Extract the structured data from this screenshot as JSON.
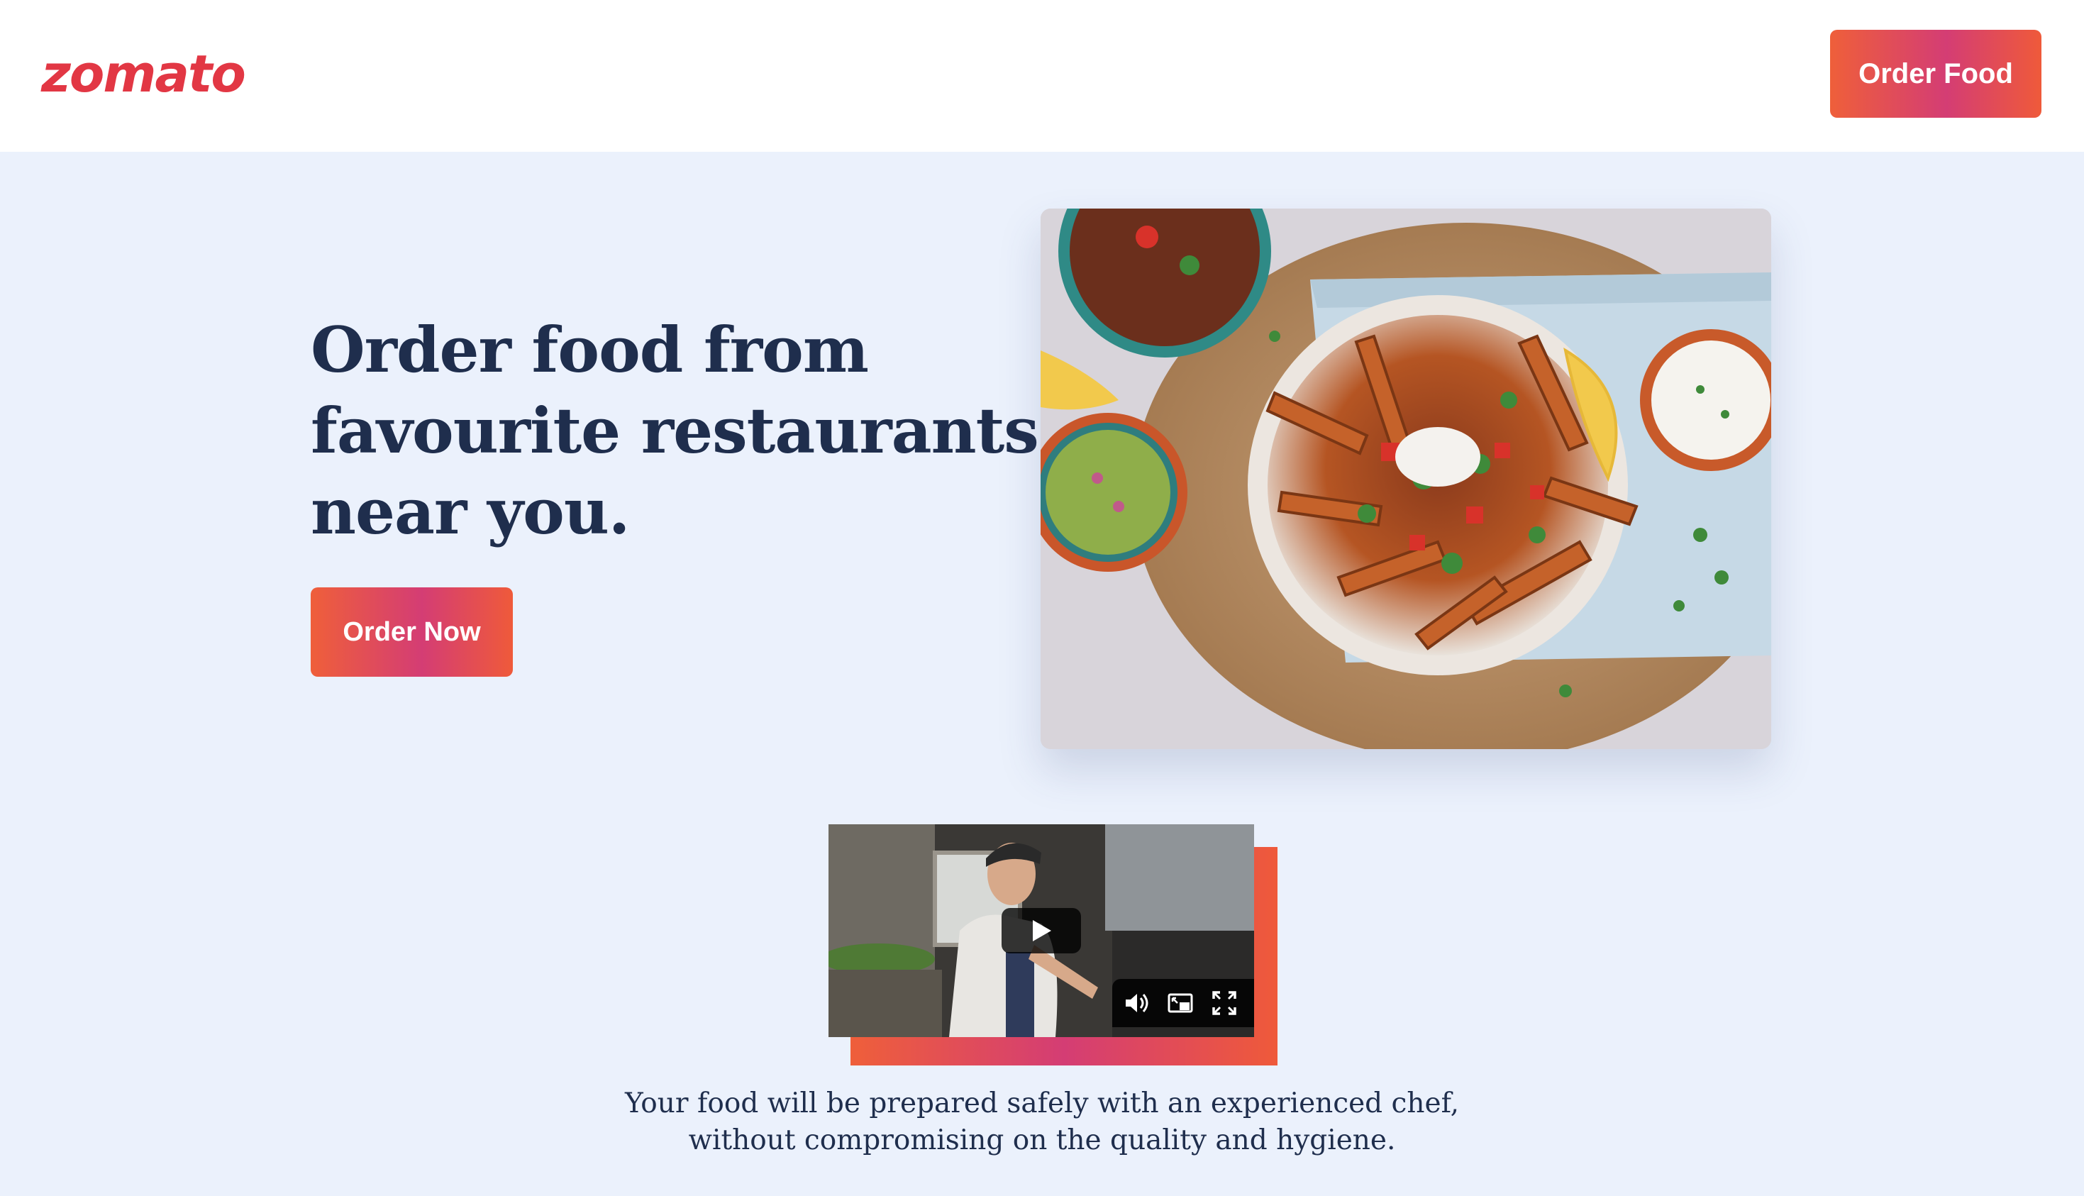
{
  "header": {
    "logo_text": "zomato",
    "order_food_label": "Order Food"
  },
  "hero": {
    "title_lines": [
      "Order food from",
      "favourite restaurants",
      "near you."
    ],
    "order_now_label": "Order Now"
  },
  "video": {
    "caption_lines": [
      "Your food will be prepared safely with an experienced chef,",
      "without compromising on the quality and hygiene."
    ],
    "icons": [
      "play-icon",
      "volume-icon",
      "picture-in-picture-icon",
      "fullscreen-icon"
    ]
  },
  "colors": {
    "brand_red": "#e23744",
    "gradient_start": "#ef5f3a",
    "gradient_mid": "#d43d74",
    "heading_navy": "#1f2e4d",
    "page_background": "#ebf1fc"
  }
}
